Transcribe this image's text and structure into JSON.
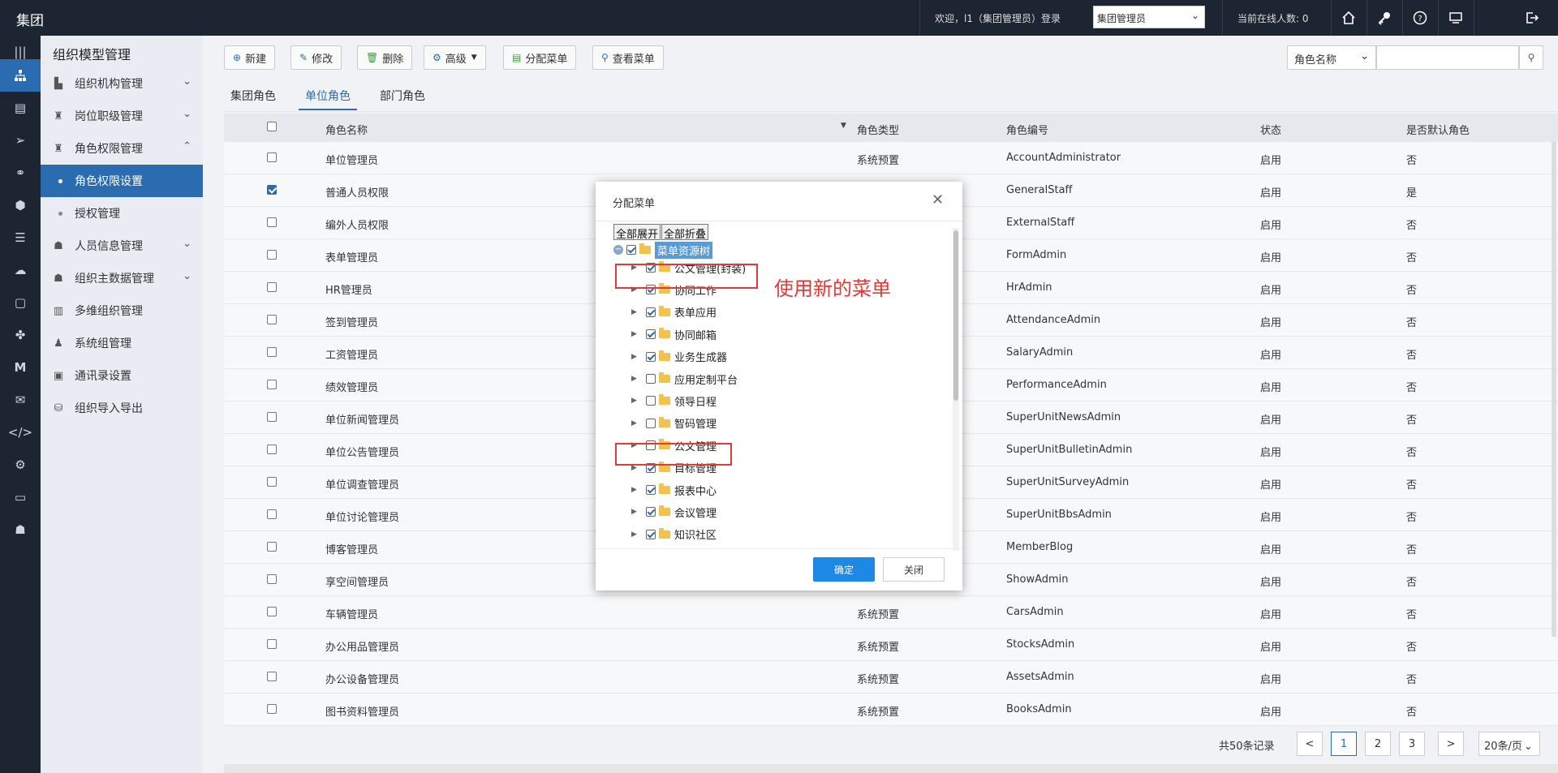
{
  "topbar": {
    "brand": "集团",
    "welcome": "欢迎，l1（集团管理员）登录",
    "role_select": "集团管理员",
    "online": "当前在线人数: 0",
    "icons": [
      "home-icon",
      "key-icon",
      "help-icon",
      "monitor-icon",
      "logout-icon"
    ]
  },
  "rail": {
    "icons": [
      "menu-icon",
      "org-tree-icon",
      "card-icon",
      "send-icon",
      "link-icon",
      "shield-icon",
      "layers-icon",
      "cloud-icon",
      "file-icon",
      "apps-icon",
      "m-icon",
      "chat-icon",
      "code-icon",
      "gear-icon",
      "desktop-icon",
      "user-icon"
    ]
  },
  "sidebar": {
    "title": "组织模型管理",
    "items": [
      {
        "label": "组织机构管理",
        "arrow": "down"
      },
      {
        "label": "岗位职级管理",
        "arrow": "down"
      },
      {
        "label": "角色权限管理",
        "arrow": "up"
      },
      {
        "label": "角色权限设置",
        "sub": true,
        "active": true
      },
      {
        "label": "授权管理",
        "sub": true
      },
      {
        "label": "人员信息管理",
        "arrow": "down"
      },
      {
        "label": "组织主数据管理",
        "arrow": "down"
      },
      {
        "label": "多维组织管理"
      },
      {
        "label": "系统组管理"
      },
      {
        "label": "通讯录设置"
      },
      {
        "label": "组织导入导出"
      }
    ]
  },
  "toolbar": {
    "new": "新建",
    "edit": "修改",
    "delete": "删除",
    "advanced": "高级",
    "assign_menu": "分配菜单",
    "view_menu": "查看菜单",
    "search_field": "角色名称",
    "search_value": ""
  },
  "tabs": [
    "集团角色",
    "单位角色",
    "部门角色"
  ],
  "table": {
    "headers": [
      "角色名称",
      "角色类型",
      "角色编号",
      "状态",
      "是否默认角色"
    ],
    "rows": [
      {
        "name": "单位管理员",
        "type": "系统预置",
        "code": "AccountAdministrator",
        "status": "启用",
        "default": "否",
        "checked": false
      },
      {
        "name": "普通人员权限",
        "type": "",
        "code": "GeneralStaff",
        "status": "启用",
        "default": "是",
        "checked": true
      },
      {
        "name": "编外人员权限",
        "type": "",
        "code": "ExternalStaff",
        "status": "启用",
        "default": "否",
        "checked": false
      },
      {
        "name": "表单管理员",
        "type": "",
        "code": "FormAdmin",
        "status": "启用",
        "default": "否",
        "checked": false
      },
      {
        "name": "HR管理员",
        "type": "",
        "code": "HrAdmin",
        "status": "启用",
        "default": "否",
        "checked": false
      },
      {
        "name": "签到管理员",
        "type": "",
        "code": "AttendanceAdmin",
        "status": "启用",
        "default": "否",
        "checked": false
      },
      {
        "name": "工资管理员",
        "type": "",
        "code": "SalaryAdmin",
        "status": "启用",
        "default": "否",
        "checked": false
      },
      {
        "name": "绩效管理员",
        "type": "",
        "code": "PerformanceAdmin",
        "status": "启用",
        "default": "否",
        "checked": false
      },
      {
        "name": "单位新闻管理员",
        "type": "",
        "code": "SuperUnitNewsAdmin",
        "status": "启用",
        "default": "否",
        "checked": false
      },
      {
        "name": "单位公告管理员",
        "type": "",
        "code": "SuperUnitBulletinAdmin",
        "status": "启用",
        "default": "否",
        "checked": false
      },
      {
        "name": "单位调查管理员",
        "type": "",
        "code": "SuperUnitSurveyAdmin",
        "status": "启用",
        "default": "否",
        "checked": false
      },
      {
        "name": "单位讨论管理员",
        "type": "",
        "code": "SuperUnitBbsAdmin",
        "status": "启用",
        "default": "否",
        "checked": false
      },
      {
        "name": "博客管理员",
        "type": "",
        "code": "MemberBlog",
        "status": "启用",
        "default": "否",
        "checked": false
      },
      {
        "name": "享空间管理员",
        "type": "",
        "code": "ShowAdmin",
        "status": "启用",
        "default": "否",
        "checked": false
      },
      {
        "name": "车辆管理员",
        "type": "系统预置",
        "code": "CarsAdmin",
        "status": "启用",
        "default": "否",
        "checked": false
      },
      {
        "name": "办公用品管理员",
        "type": "系统预置",
        "code": "StocksAdmin",
        "status": "启用",
        "default": "否",
        "checked": false
      },
      {
        "name": "办公设备管理员",
        "type": "系统预置",
        "code": "AssetsAdmin",
        "status": "启用",
        "default": "否",
        "checked": false
      },
      {
        "name": "图书资料管理员",
        "type": "系统预置",
        "code": "BooksAdmin",
        "status": "启用",
        "default": "否",
        "checked": false
      }
    ]
  },
  "pagination": {
    "total": "共50条记录",
    "prev": "<",
    "pages": [
      "1",
      "2",
      "3"
    ],
    "next": ">",
    "page_size": "20条/页"
  },
  "modal": {
    "title": "分配菜单",
    "expand_all": "全部展开",
    "collapse_all": "全部折叠",
    "root": "菜单资源树",
    "nodes": [
      {
        "label": "公文管理(封装)",
        "checked": true
      },
      {
        "label": "协同工作",
        "checked": true
      },
      {
        "label": "表单应用",
        "checked": true
      },
      {
        "label": "协同邮箱",
        "checked": true
      },
      {
        "label": "业务生成器",
        "checked": true
      },
      {
        "label": "应用定制平台",
        "checked": false
      },
      {
        "label": "领导日程",
        "checked": false
      },
      {
        "label": "智码管理",
        "checked": false
      },
      {
        "label": "公文管理",
        "checked": false
      },
      {
        "label": "目标管理",
        "checked": true
      },
      {
        "label": "报表中心",
        "checked": true
      },
      {
        "label": "会议管理",
        "checked": true
      },
      {
        "label": "知识社区",
        "checked": true
      }
    ],
    "ok": "确定",
    "close": "关闭"
  },
  "annotation": {
    "text": "使用新的菜单",
    "color": "#e53935"
  }
}
